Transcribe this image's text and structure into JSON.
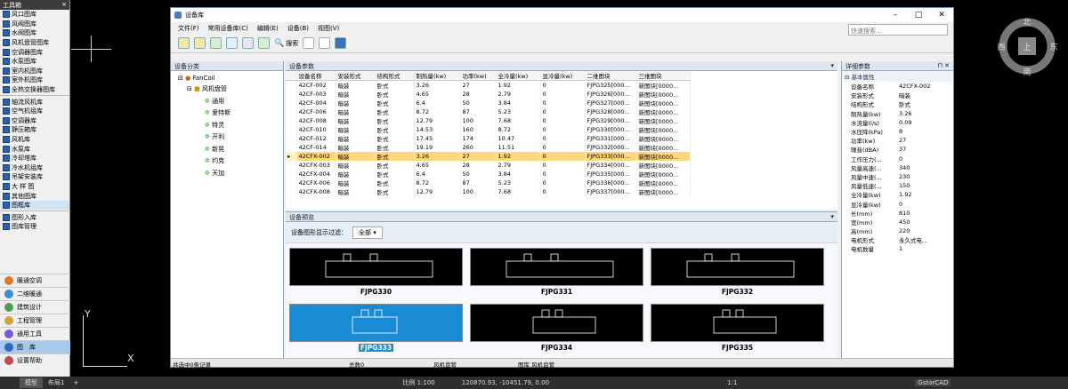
{
  "toolbox": {
    "title": "工具箱",
    "items": [
      "风口图库",
      "风阀图库",
      "水阀图库",
      "风机盘管图库",
      "空调器图库",
      "水泵图库",
      "室内机图库",
      "室外机图库",
      "全热交换器图库",
      "轴流风机库",
      "空气机组库",
      "空调器库",
      "静压箱库",
      "风机库",
      "水泵库",
      "冷却塔库",
      "冷水机组库",
      "吊架安装库",
      "大 样 图",
      "其他图库",
      "图框库",
      "图形入库",
      "图库管理"
    ],
    "modules": [
      "暖通空调",
      "二维暖通",
      "建筑设计",
      "工程管理",
      "通用工具",
      "图　库",
      "设置帮助"
    ]
  },
  "cad": {
    "axis_y": "Y",
    "axis_x": "X",
    "compass": {
      "n": "北",
      "s": "南",
      "e": "东",
      "w": "西",
      "center": "上"
    }
  },
  "dialog": {
    "title": "设备库",
    "menus": [
      "文件(F)",
      "常用设备库(C)",
      "编辑(E)",
      "设备(B)",
      "视图(V)"
    ],
    "search_btn": "搜索",
    "search_placeholder": "快速搜索...",
    "left_panel": {
      "header": "设备分类",
      "root": "FanCoil",
      "node": "风机盘管",
      "children": [
        "通用",
        "爱特斯",
        "特灵",
        "开利",
        "新晃",
        "约克",
        "天加"
      ]
    },
    "grid": {
      "header": "设备参数",
      "columns": [
        "设备名称",
        "安装形式",
        "结构形式",
        "制热量(kw)",
        "功率(kw)",
        "全冷量(kw)",
        "显冷量(kw)",
        "二维图块",
        "三维图块"
      ],
      "rows": [
        [
          "42CF-002",
          "暗装",
          "卧式",
          "3.26",
          "27",
          "1.92",
          "0",
          "FJPG325[000...",
          "新图块[0000..."
        ],
        [
          "42CF-003",
          "暗装",
          "卧式",
          "4.65",
          "28",
          "2.79",
          "0",
          "FJPG326[000...",
          "新图块[0000..."
        ],
        [
          "42CF-004",
          "暗装",
          "卧式",
          "6.4",
          "50",
          "3.84",
          "0",
          "FJPG327[000...",
          "新图块[0000..."
        ],
        [
          "42CF-006",
          "暗装",
          "卧式",
          "8.72",
          "87",
          "5.23",
          "0",
          "FJPG328[000...",
          "新图块[0000..."
        ],
        [
          "42CF-008",
          "暗装",
          "卧式",
          "12.79",
          "100",
          "7.68",
          "0",
          "FJPG329[000...",
          "新图块[0000..."
        ],
        [
          "42CF-010",
          "暗装",
          "卧式",
          "14.53",
          "160",
          "8.72",
          "0",
          "FJPG330[000...",
          "新图块[0000..."
        ],
        [
          "42CF-012",
          "暗装",
          "卧式",
          "17.45",
          "174",
          "10.47",
          "0",
          "FJPG331[000...",
          "新图块[0000..."
        ],
        [
          "42CF-014",
          "暗装",
          "卧式",
          "19.19",
          "260",
          "11.51",
          "0",
          "FJPG332[000...",
          "新图块[0000..."
        ],
        [
          "42CFX-002",
          "暗装",
          "卧式",
          "3.26",
          "27",
          "1.92",
          "0",
          "FJPG333[000...",
          "新图块[0000..."
        ],
        [
          "42CFX-003",
          "暗装",
          "卧式",
          "4.65",
          "28",
          "2.79",
          "0",
          "FJPG334[000...",
          "新图块[0000..."
        ],
        [
          "42CFX-004",
          "暗装",
          "卧式",
          "6.4",
          "50",
          "3.84",
          "0",
          "FJPG335[000...",
          "新图块[0000..."
        ],
        [
          "42CFX-006",
          "暗装",
          "卧式",
          "8.72",
          "87",
          "5.23",
          "0",
          "FJPG336[000...",
          "新图块[0000..."
        ],
        [
          "42CFX-008",
          "暗装",
          "卧式",
          "12.79",
          "100",
          "7.68",
          "0",
          "FJPG337[000...",
          "新图块[0000..."
        ]
      ],
      "selected_row": 8
    },
    "preview": {
      "header": "设备预览",
      "filter_label": "设备图形显示过滤：",
      "filter_value": "全部",
      "items": [
        "FJPG330",
        "FJPG331",
        "FJPG332",
        "FJPG333",
        "FJPG334",
        "FJPG335"
      ],
      "selected": 3
    },
    "detail": {
      "header": "详细参数",
      "group": "基本属性",
      "rows": [
        [
          "设备名称",
          "42CFX-002"
        ],
        [
          "安装形式",
          "暗装"
        ],
        [
          "结构形式",
          "卧式"
        ],
        [
          "制热量(kw)",
          "3.26"
        ],
        [
          "水流量(l/s)",
          "0.09"
        ],
        [
          "水压降(kPa)",
          "8"
        ],
        [
          "功率(kw)",
          "27"
        ],
        [
          "噪音(dBA)",
          "37"
        ],
        [
          "工作压力(...",
          "0"
        ],
        [
          "风量高速(...",
          "340"
        ],
        [
          "风量中速(...",
          "230"
        ],
        [
          "风量低速(...",
          "150"
        ],
        [
          "全冷量(kw)",
          "1.92"
        ],
        [
          "显冷量(kw)",
          "0"
        ],
        [
          "长(mm)",
          "810"
        ],
        [
          "宽(mm)",
          "450"
        ],
        [
          "高(mm)",
          "220"
        ],
        [
          "电机形式",
          "永久式电..."
        ],
        [
          "电机数量",
          "1"
        ]
      ]
    },
    "statusbar": [
      "共选中0条记录",
      "总数0",
      "风机盘管",
      "图库  风机盘管"
    ]
  },
  "status": {
    "tab_model": "模型",
    "tab_layout": "布局1",
    "scale": "比例 1:100",
    "coords": "120870.93, -10451.79, 0.00",
    "zoom": "1:1",
    "app": "GstarCAD"
  }
}
